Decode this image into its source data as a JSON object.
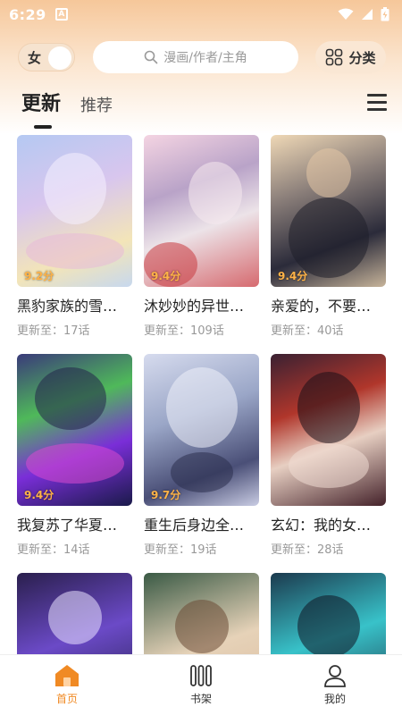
{
  "status_bar": {
    "time": "6:29",
    "app_badge": "A"
  },
  "topbar": {
    "gender_label": "女",
    "search_placeholder": "漫画/作者/主角",
    "category_label": "分类"
  },
  "tabs": [
    {
      "label": "更新",
      "active": true
    },
    {
      "label": "推荐",
      "active": false
    }
  ],
  "comics": [
    {
      "title": "黑豹家族的雪…",
      "update": "更新至：17话",
      "rating": "9.2分"
    },
    {
      "title": "沐妙妙的异世…",
      "update": "更新至：109话",
      "rating": "9.4分"
    },
    {
      "title": "亲爱的，不要…",
      "update": "更新至：40话",
      "rating": "9.4分"
    },
    {
      "title": "我复苏了华夏…",
      "update": "更新至：14话",
      "rating": "9.4分"
    },
    {
      "title": "重生后身边全…",
      "update": "更新至：19话",
      "rating": "9.7分"
    },
    {
      "title": "玄幻：我的女…",
      "update": "更新至：28话",
      "rating": ""
    }
  ],
  "bottom_nav": [
    {
      "label": "首页",
      "icon": "home-icon",
      "active": true
    },
    {
      "label": "书架",
      "icon": "bookshelf-icon",
      "active": false
    },
    {
      "label": "我的",
      "icon": "profile-icon",
      "active": false
    }
  ],
  "colors": {
    "accent": "#f08a24",
    "header_gradient_top": "#f6c79a"
  }
}
